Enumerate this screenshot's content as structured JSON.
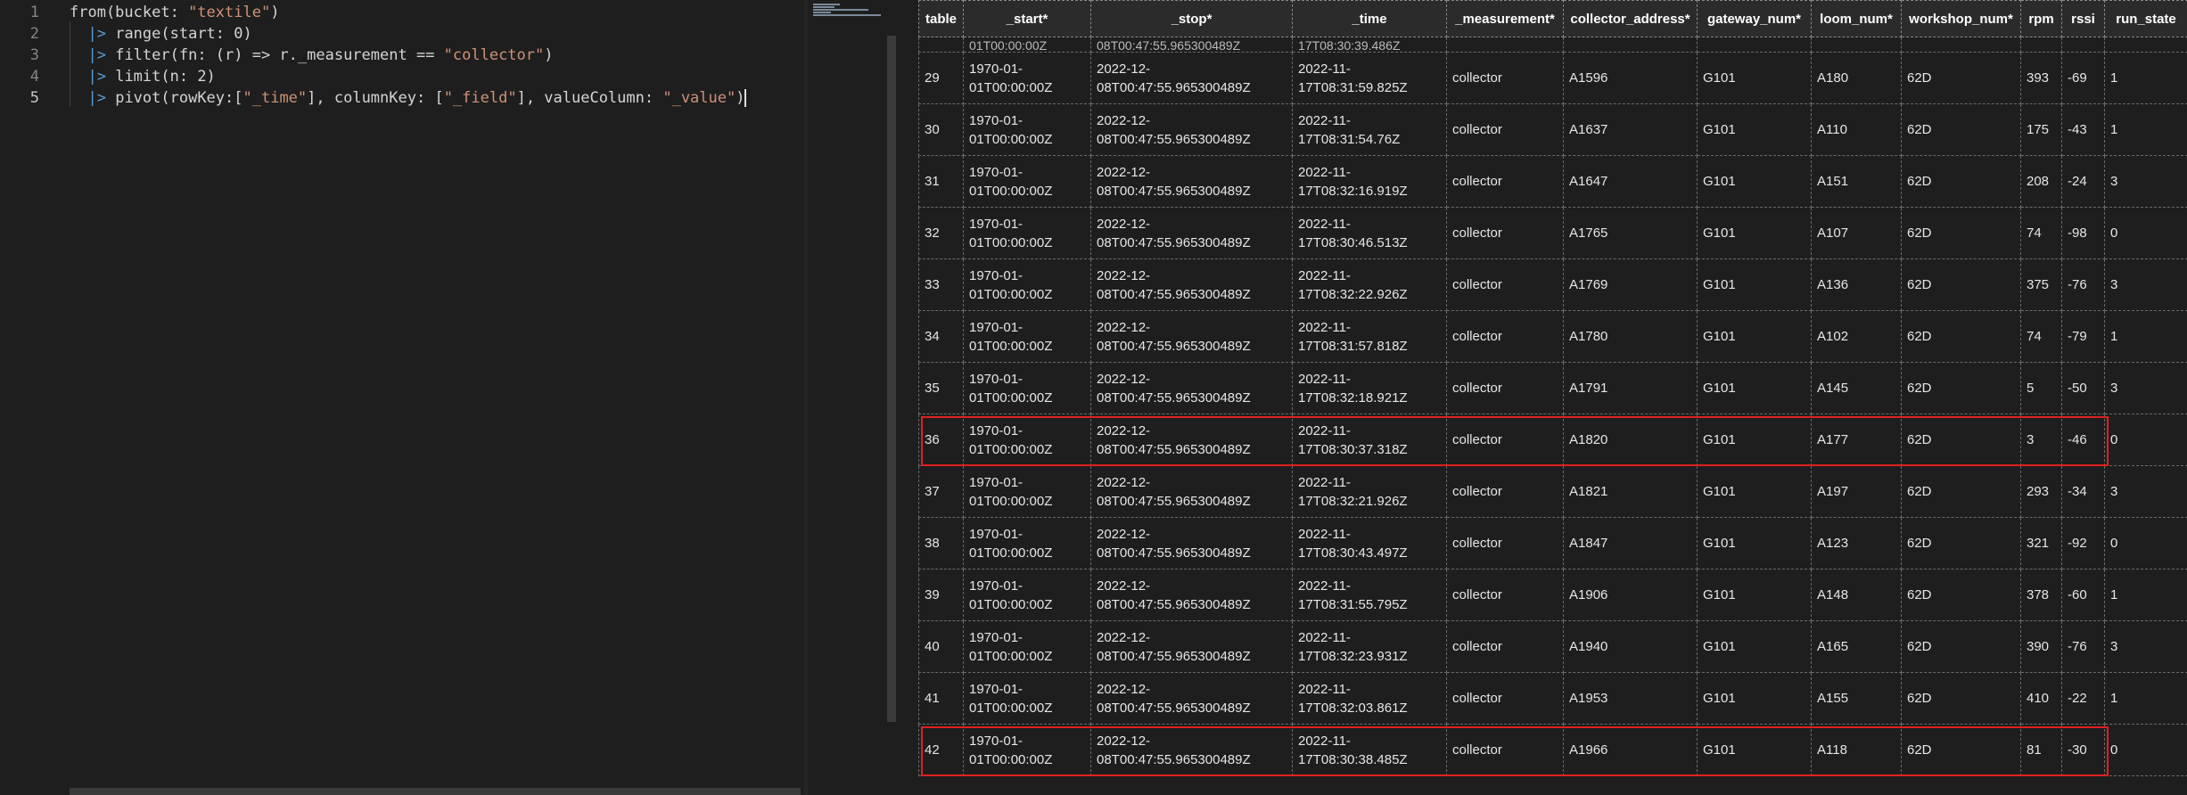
{
  "editor": {
    "lines": [
      {
        "num": "1",
        "segments": [
          {
            "t": "from(bucket: ",
            "c": ""
          },
          {
            "t": "\"textile\"",
            "c": "str"
          },
          {
            "t": ")",
            "c": ""
          }
        ]
      },
      {
        "num": "2",
        "segments": [
          {
            "t": "  ",
            "c": ""
          },
          {
            "t": "|>",
            "c": "pipe"
          },
          {
            "t": " range(start: 0)",
            "c": ""
          }
        ]
      },
      {
        "num": "3",
        "segments": [
          {
            "t": "  ",
            "c": ""
          },
          {
            "t": "|>",
            "c": "pipe"
          },
          {
            "t": " filter(fn: (r) => r._measurement == ",
            "c": ""
          },
          {
            "t": "\"collector\"",
            "c": "str"
          },
          {
            "t": ")",
            "c": ""
          }
        ]
      },
      {
        "num": "4",
        "segments": [
          {
            "t": "  ",
            "c": ""
          },
          {
            "t": "|>",
            "c": "pipe"
          },
          {
            "t": " limit(n: 2)",
            "c": ""
          }
        ]
      },
      {
        "num": "5",
        "segments": [
          {
            "t": "  ",
            "c": ""
          },
          {
            "t": "|>",
            "c": "pipe"
          },
          {
            "t": " pivot(rowKey:[",
            "c": ""
          },
          {
            "t": "\"_time\"",
            "c": "str"
          },
          {
            "t": "], columnKey: [",
            "c": ""
          },
          {
            "t": "\"_field\"",
            "c": "str"
          },
          {
            "t": "], valueColumn: ",
            "c": ""
          },
          {
            "t": "\"_value\"",
            "c": "str"
          },
          {
            "t": ")",
            "c": ""
          }
        ]
      }
    ],
    "active_line": "5"
  },
  "results": {
    "columns": [
      "table",
      "_start*",
      "_stop*",
      "_time",
      "_measurement*",
      "collector_address*",
      "gateway_num*",
      "loom_num*",
      "workshop_num*",
      "rpm",
      "rssi",
      "run_state"
    ],
    "partial_row": [
      "",
      "01T00:00:00Z",
      "08T00:47:55.965300489Z",
      "17T08:30:39.486Z",
      "",
      "",
      "",
      "",
      "",
      "",
      "",
      ""
    ],
    "rows": [
      [
        "29",
        "1970-01-\n01T00:00:00Z",
        "2022-12-\n08T00:47:55.965300489Z",
        "2022-11-\n17T08:31:59.825Z",
        "collector",
        "A1596",
        "G101",
        "A180",
        "62D",
        "393",
        "-69",
        "1"
      ],
      [
        "30",
        "1970-01-\n01T00:00:00Z",
        "2022-12-\n08T00:47:55.965300489Z",
        "2022-11-\n17T08:31:54.76Z",
        "collector",
        "A1637",
        "G101",
        "A110",
        "62D",
        "175",
        "-43",
        "1"
      ],
      [
        "31",
        "1970-01-\n01T00:00:00Z",
        "2022-12-\n08T00:47:55.965300489Z",
        "2022-11-\n17T08:32:16.919Z",
        "collector",
        "A1647",
        "G101",
        "A151",
        "62D",
        "208",
        "-24",
        "3"
      ],
      [
        "32",
        "1970-01-\n01T00:00:00Z",
        "2022-12-\n08T00:47:55.965300489Z",
        "2022-11-\n17T08:30:46.513Z",
        "collector",
        "A1765",
        "G101",
        "A107",
        "62D",
        "74",
        "-98",
        "0"
      ],
      [
        "33",
        "1970-01-\n01T00:00:00Z",
        "2022-12-\n08T00:47:55.965300489Z",
        "2022-11-\n17T08:32:22.926Z",
        "collector",
        "A1769",
        "G101",
        "A136",
        "62D",
        "375",
        "-76",
        "3"
      ],
      [
        "34",
        "1970-01-\n01T00:00:00Z",
        "2022-12-\n08T00:47:55.965300489Z",
        "2022-11-\n17T08:31:57.818Z",
        "collector",
        "A1780",
        "G101",
        "A102",
        "62D",
        "74",
        "-79",
        "1"
      ],
      [
        "35",
        "1970-01-\n01T00:00:00Z",
        "2022-12-\n08T00:47:55.965300489Z",
        "2022-11-\n17T08:32:18.921Z",
        "collector",
        "A1791",
        "G101",
        "A145",
        "62D",
        "5",
        "-50",
        "3"
      ],
      [
        "36",
        "1970-01-\n01T00:00:00Z",
        "2022-12-\n08T00:47:55.965300489Z",
        "2022-11-\n17T08:30:37.318Z",
        "collector",
        "A1820",
        "G101",
        "A177",
        "62D",
        "3",
        "-46",
        "0"
      ],
      [
        "37",
        "1970-01-\n01T00:00:00Z",
        "2022-12-\n08T00:47:55.965300489Z",
        "2022-11-\n17T08:32:21.926Z",
        "collector",
        "A1821",
        "G101",
        "A197",
        "62D",
        "293",
        "-34",
        "3"
      ],
      [
        "38",
        "1970-01-\n01T00:00:00Z",
        "2022-12-\n08T00:47:55.965300489Z",
        "2022-11-\n17T08:30:43.497Z",
        "collector",
        "A1847",
        "G101",
        "A123",
        "62D",
        "321",
        "-92",
        "0"
      ],
      [
        "39",
        "1970-01-\n01T00:00:00Z",
        "2022-12-\n08T00:47:55.965300489Z",
        "2022-11-\n17T08:31:55.795Z",
        "collector",
        "A1906",
        "G101",
        "A148",
        "62D",
        "378",
        "-60",
        "1"
      ],
      [
        "40",
        "1970-01-\n01T00:00:00Z",
        "2022-12-\n08T00:47:55.965300489Z",
        "2022-11-\n17T08:32:23.931Z",
        "collector",
        "A1940",
        "G101",
        "A165",
        "62D",
        "390",
        "-76",
        "3"
      ],
      [
        "41",
        "1970-01-\n01T00:00:00Z",
        "2022-12-\n08T00:47:55.965300489Z",
        "2022-11-\n17T08:32:03.861Z",
        "collector",
        "A1953",
        "G101",
        "A155",
        "62D",
        "410",
        "-22",
        "1"
      ],
      [
        "42",
        "1970-01-\n01T00:00:00Z",
        "2022-12-\n08T00:47:55.965300489Z",
        "2022-11-\n17T08:30:38.485Z",
        "collector",
        "A1966",
        "G101",
        "A118",
        "62D",
        "81",
        "-30",
        "0"
      ]
    ],
    "highlighted_rows": [
      "36",
      "42"
    ]
  },
  "colors": {
    "highlight": "#e02020",
    "keyword_pipe": "#569cd6",
    "string": "#ce9178"
  }
}
